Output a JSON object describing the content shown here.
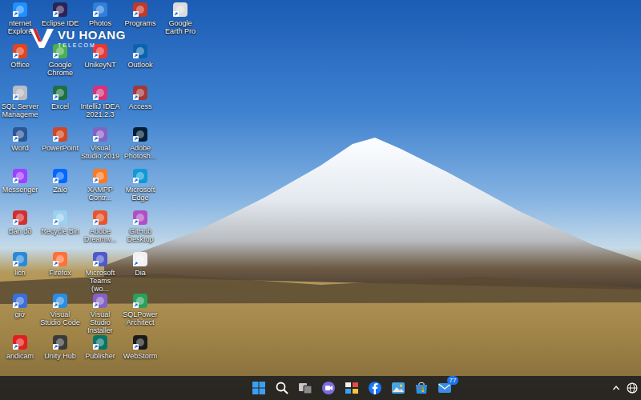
{
  "watermark": {
    "brand": "VU HOANG",
    "sub": "TELECOM"
  },
  "desktop": {
    "icons": [
      {
        "label": "nternet Explore",
        "color": "#1e90ff"
      },
      {
        "label": "Office",
        "color": "#e0451f"
      },
      {
        "label": "SQL Server Manageme",
        "color": "#b8bcc4"
      },
      {
        "label": "Word",
        "color": "#2b5797"
      },
      {
        "label": "Messenger",
        "color": "#a040ff"
      },
      {
        "label": "Bản đồ",
        "color": "#d03030"
      },
      {
        "label": "lich",
        "color": "#2b8ad8"
      },
      {
        "label": "giờ",
        "color": "#3a6fd8"
      },
      {
        "label": "andicam",
        "color": "#e02020"
      },
      {
        "label": "Eclipse IDE",
        "color": "#2c2255"
      },
      {
        "label": "Google Chrome",
        "color": "#4caf50"
      },
      {
        "label": "Excel",
        "color": "#1d7044"
      },
      {
        "label": "PowerPoint",
        "color": "#d24726"
      },
      {
        "label": "Zalo",
        "color": "#0068ff"
      },
      {
        "label": "Recycle Bin",
        "color": "#9ad0f0"
      },
      {
        "label": "Firefox",
        "color": "#ff7139"
      },
      {
        "label": "Visual Studio Code",
        "color": "#2a8de0"
      },
      {
        "label": "Unity Hub",
        "color": "#3a3a3a"
      },
      {
        "label": "Photos",
        "color": "#2f7fdc"
      },
      {
        "label": "UnikeyNT",
        "color": "#e53935"
      },
      {
        "label": "IntelliJ IDEA 2021.2.3",
        "color": "#d6327a"
      },
      {
        "label": "Visual Studio 2019",
        "color": "#8661c5"
      },
      {
        "label": "XAMPP Contr...",
        "color": "#fb7a24"
      },
      {
        "label": "Adobe Dreamw...",
        "color": "#e7552c"
      },
      {
        "label": "Microsoft Teams (wo...",
        "color": "#5059c9"
      },
      {
        "label": "Visual Studio Installer",
        "color": "#8661c5"
      },
      {
        "label": "Publisher",
        "color": "#077568"
      },
      {
        "label": "Programs",
        "color": "#c0392b"
      },
      {
        "label": "Outlook",
        "color": "#0a64ad"
      },
      {
        "label": "Access",
        "color": "#a4373a"
      },
      {
        "label": "Adobe Photosh...",
        "color": "#001e36"
      },
      {
        "label": "Microsoft Edge",
        "color": "#0f9ad7"
      },
      {
        "label": "GitHub Desktop",
        "color": "#b04fc4"
      },
      {
        "label": "Dia",
        "color": "#f0f0f0"
      },
      {
        "label": "SQLPower Architect",
        "color": "#2aa05a"
      },
      {
        "label": "WebStorm",
        "color": "#1a1a1a"
      },
      {
        "label": "Google Earth Pro",
        "color": "#dcdcdc"
      }
    ]
  },
  "taskbar": {
    "apps": [
      {
        "kind": "start",
        "color": "#3aa0f3"
      },
      {
        "kind": "search",
        "color": "#ffffff"
      },
      {
        "kind": "taskview",
        "color": "#c8c8c8"
      },
      {
        "kind": "chat",
        "color": "#7b6ce0"
      },
      {
        "kind": "widgets",
        "color": "#e0504a"
      },
      {
        "kind": "facebook",
        "color": "#1877f2"
      },
      {
        "kind": "photo",
        "color": "#4aa3df"
      },
      {
        "kind": "store",
        "color": "#2f8ee0"
      },
      {
        "kind": "mail",
        "color": "#3a8ee6",
        "badge": "77"
      }
    ]
  }
}
